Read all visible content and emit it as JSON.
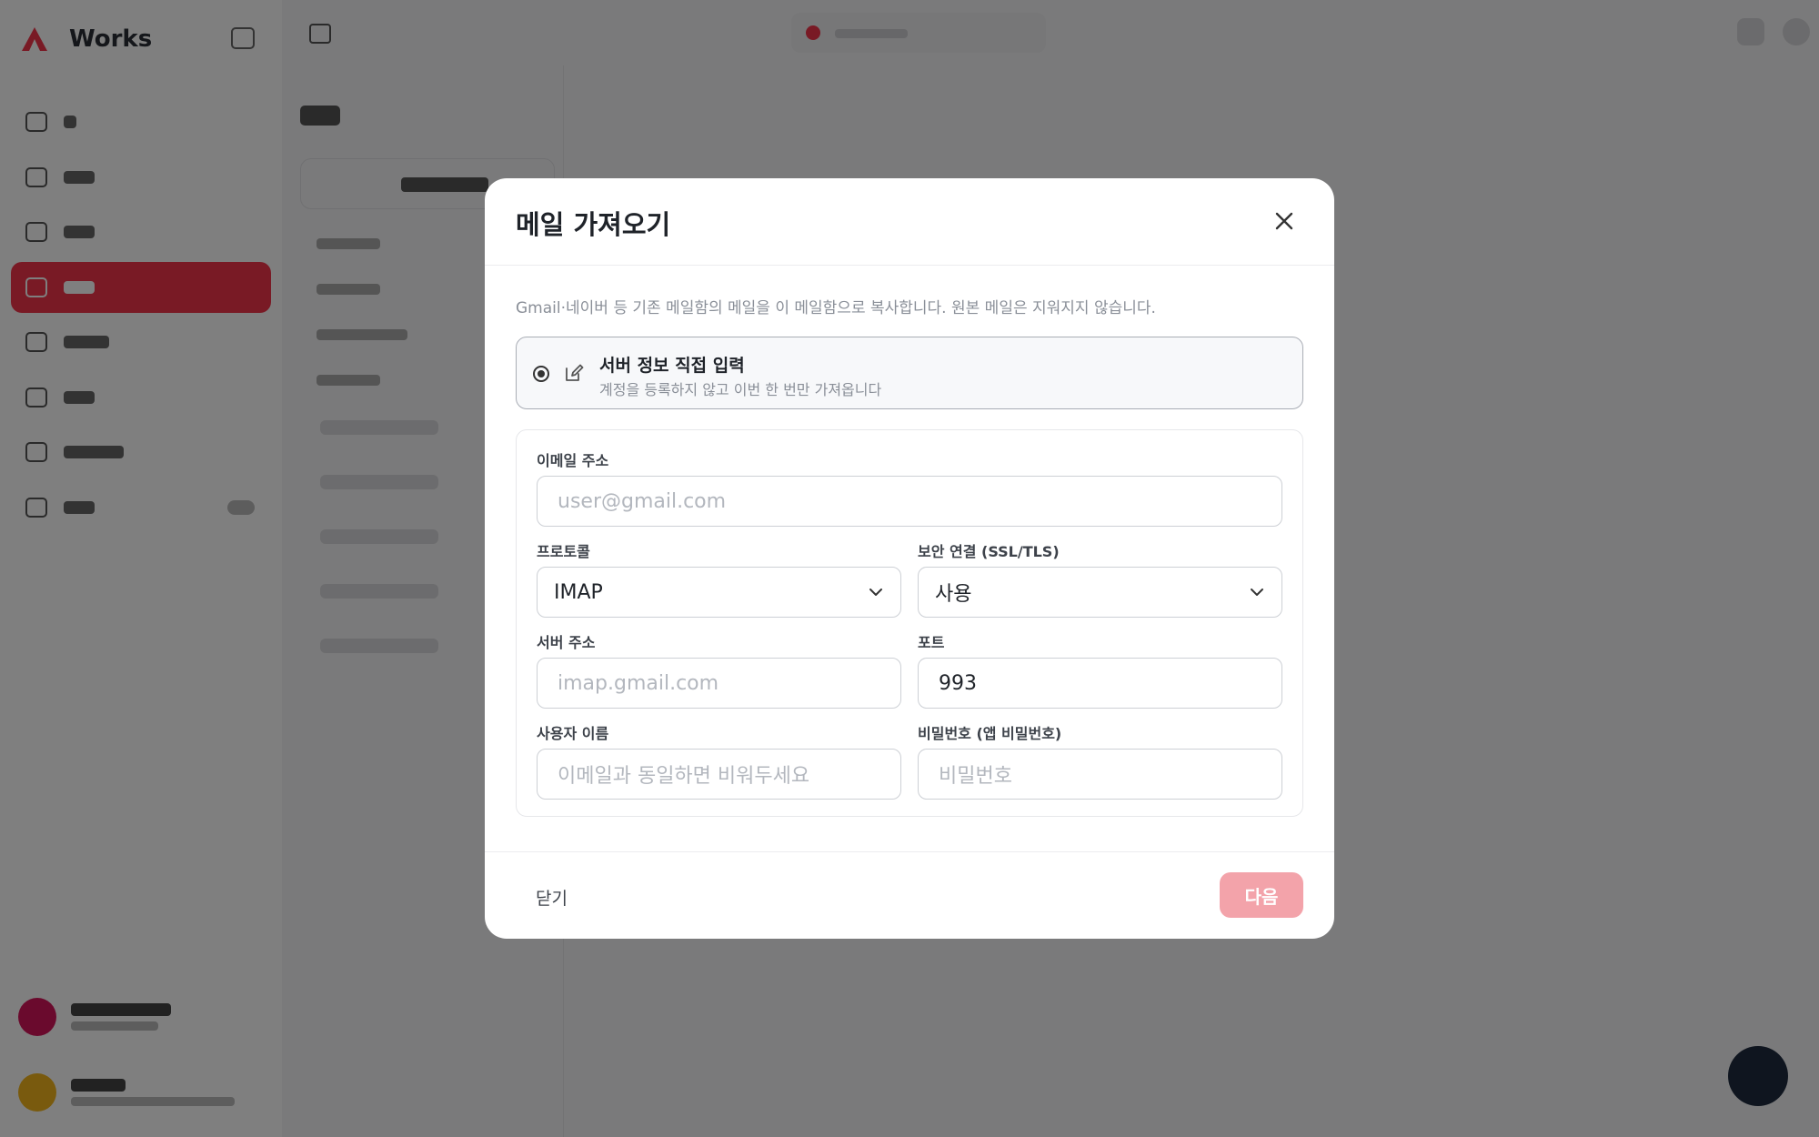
{
  "app": {
    "name": "Works",
    "brand_color": "#f3344a",
    "nav": [
      {
        "icon": "home-icon",
        "active": false
      },
      {
        "icon": "board-icon",
        "active": false
      },
      {
        "icon": "calendar-icon",
        "active": false
      },
      {
        "icon": "mail-icon",
        "active": true
      },
      {
        "icon": "message-icon",
        "active": false
      },
      {
        "icon": "folder-icon",
        "active": false
      },
      {
        "icon": "clock-icon",
        "active": false
      },
      {
        "icon": "more-icon",
        "active": false
      }
    ]
  },
  "modal": {
    "title": "메일 가져오기",
    "description": "Gmail·네이버 등 기존 메일함의 메일을 이 메일함으로 복사합니다. 원본 메일은 지워지지 않습니다.",
    "option": {
      "title": "서버 정보 직접 입력",
      "subtitle": "계정을 등록하지 않고 이번 한 번만 가져옵니다",
      "selected": true
    },
    "form": {
      "email": {
        "label": "이메일 주소",
        "placeholder": "user@gmail.com",
        "value": ""
      },
      "protocol": {
        "label": "프로토콜",
        "value": "IMAP"
      },
      "security": {
        "label": "보안 연결 (SSL/TLS)",
        "value": "사용"
      },
      "server": {
        "label": "서버 주소",
        "placeholder": "imap.gmail.com",
        "value": ""
      },
      "port": {
        "label": "포트",
        "value": "993"
      },
      "username": {
        "label": "사용자 이름",
        "placeholder": "이메일과 동일하면 비워두세요",
        "value": ""
      },
      "password": {
        "label": "비밀번호 (앱 비밀번호)",
        "placeholder": "비밀번호",
        "value": ""
      }
    },
    "footer": {
      "close_label": "닫기",
      "next_label": "다음",
      "next_color": "#f3a3aa"
    }
  }
}
